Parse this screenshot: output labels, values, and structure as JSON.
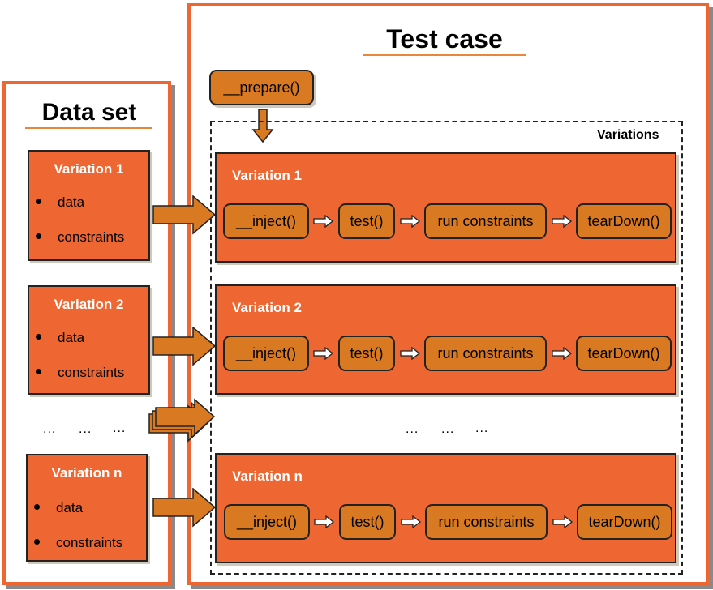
{
  "data_set": {
    "title": "Data set",
    "variations": [
      {
        "label": "Variation 1",
        "items": [
          "data",
          "constraints"
        ]
      },
      {
        "label": "Variation 2",
        "items": [
          "data",
          "constraints"
        ]
      },
      {
        "label": "Variation n",
        "items": [
          "data",
          "constraints"
        ]
      }
    ],
    "ellipsis": [
      "...",
      "...",
      "..."
    ]
  },
  "test_case": {
    "title": "Test case",
    "prepare": "__prepare()",
    "variations_label": "Variations",
    "variations": [
      {
        "label": "Variation 1",
        "steps": [
          "__inject()",
          "test()",
          "run constraints",
          "tearDown()"
        ]
      },
      {
        "label": "Variation 2",
        "steps": [
          "__inject()",
          "test()",
          "run constraints",
          "tearDown()"
        ]
      },
      {
        "label": "Variation n",
        "steps": [
          "__inject()",
          "test()",
          "run constraints",
          "tearDown()"
        ]
      }
    ],
    "ellipsis": [
      "...",
      "...",
      "..."
    ]
  },
  "colors": {
    "panel_border": "#ee6631",
    "box_fill": "#ee6631",
    "step_fill": "#d97a22",
    "arrow_fill": "#d97a22",
    "shadow": "#8a8a8a"
  }
}
